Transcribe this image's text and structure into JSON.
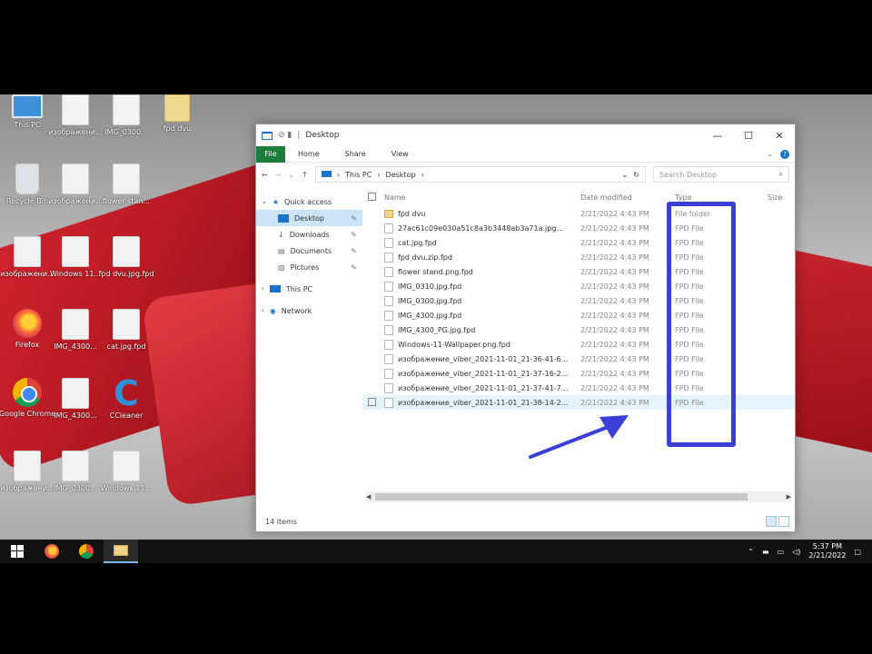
{
  "desktop": {
    "icons": [
      {
        "label": "This PC",
        "kind": "pc"
      },
      {
        "label": "изображени...",
        "kind": "file"
      },
      {
        "label": "IMG_0300...",
        "kind": "file"
      },
      {
        "label": "fpd dvu",
        "kind": "folder"
      },
      {
        "label": "Recycle Bin",
        "kind": "bin"
      },
      {
        "label": "изображени...",
        "kind": "file"
      },
      {
        "label": "flower stan...",
        "kind": "file"
      },
      {
        "label": "изображени...",
        "kind": "file"
      },
      {
        "label": "Windows 11...",
        "kind": "file"
      },
      {
        "label": "fpd dvu.jpg.fpd",
        "kind": "file"
      },
      {
        "label": "Firefox",
        "kind": "firefox"
      },
      {
        "label": "IMG_4300...",
        "kind": "file"
      },
      {
        "label": "cat.jpg.fpd",
        "kind": "file"
      },
      {
        "label": "Google Chrome",
        "kind": "chrome"
      },
      {
        "label": "IMG_4300...",
        "kind": "file"
      },
      {
        "label": "CCleaner",
        "kind": "ccleaner"
      },
      {
        "label": "изображени...",
        "kind": "file"
      },
      {
        "label": "IMG_0300...",
        "kind": "file"
      },
      {
        "label": "Windows 11...",
        "kind": "file"
      }
    ]
  },
  "window": {
    "title": "Desktop",
    "controls": {
      "minimize": "—",
      "maximize": "☐",
      "close": "✕"
    },
    "ribbon": {
      "file": "File",
      "home": "Home",
      "share": "Share",
      "view": "View",
      "help": "?"
    },
    "address": {
      "path": [
        "This PC",
        "Desktop"
      ],
      "search_placeholder": "Search Desktop"
    },
    "nav": {
      "quick_access": "Quick access",
      "desktop": "Desktop",
      "downloads": "Downloads",
      "documents": "Documents",
      "pictures": "Pictures",
      "this_pc": "This PC",
      "network": "Network"
    },
    "columns": {
      "name": "Name",
      "date": "Date modified",
      "type": "Type",
      "size": "Size"
    },
    "files": [
      {
        "name": "fpd dvu",
        "date": "2/21/2022 4:43 PM",
        "type": "File folder",
        "folder": true
      },
      {
        "name": "27ac61c09e030a51c8a3b3448ab3a71a.jpg...",
        "date": "2/21/2022 4:43 PM",
        "type": "FPD File",
        "folder": false
      },
      {
        "name": "cat.jpg.fpd",
        "date": "2/21/2022 4:43 PM",
        "type": "FPD File",
        "folder": false
      },
      {
        "name": "fpd dvu.zip.fpd",
        "date": "2/21/2022 4:43 PM",
        "type": "FPD File",
        "folder": false
      },
      {
        "name": "flower stand.png.fpd",
        "date": "2/21/2022 4:43 PM",
        "type": "FPD File",
        "folder": false
      },
      {
        "name": "IMG_0310.jpg.fpd",
        "date": "2/21/2022 4:43 PM",
        "type": "FPD File",
        "folder": false
      },
      {
        "name": "IMG_0300.jpg.fpd",
        "date": "2/21/2022 4:43 PM",
        "type": "FPD File",
        "folder": false
      },
      {
        "name": "IMG_4300.jpg.fpd",
        "date": "2/21/2022 4:43 PM",
        "type": "FPD File",
        "folder": false
      },
      {
        "name": "IMG_4300_PG.jpg.fpd",
        "date": "2/21/2022 4:43 PM",
        "type": "FPD File",
        "folder": false
      },
      {
        "name": "Windows-11-Wallpaper.png.fpd",
        "date": "2/21/2022 4:43 PM",
        "type": "FPD File",
        "folder": false
      },
      {
        "name": "изображение_viber_2021-11-01_21-36-41-6...",
        "date": "2/21/2022 4:43 PM",
        "type": "FPD File",
        "folder": false
      },
      {
        "name": "изображение_viber_2021-11-01_21-37-16-2...",
        "date": "2/21/2022 4:43 PM",
        "type": "FPD File",
        "folder": false
      },
      {
        "name": "изображение_viber_2021-11-01_21-37-41-7...",
        "date": "2/21/2022 4:43 PM",
        "type": "FPD File",
        "folder": false
      },
      {
        "name": "изображение_viber_2021-11-01_21-38-14-2...",
        "date": "2/21/2022 4:43 PM",
        "type": "FPD File",
        "folder": false
      }
    ],
    "status": "14 items"
  },
  "taskbar": {
    "clock_time": "5:37 PM",
    "clock_date": "2/21/2022"
  },
  "colors": {
    "highlight_box": "#3b3fd6",
    "arrow": "#3b3fd6",
    "file_tab": "#1c7c3a",
    "selection": "#cce4f7"
  }
}
